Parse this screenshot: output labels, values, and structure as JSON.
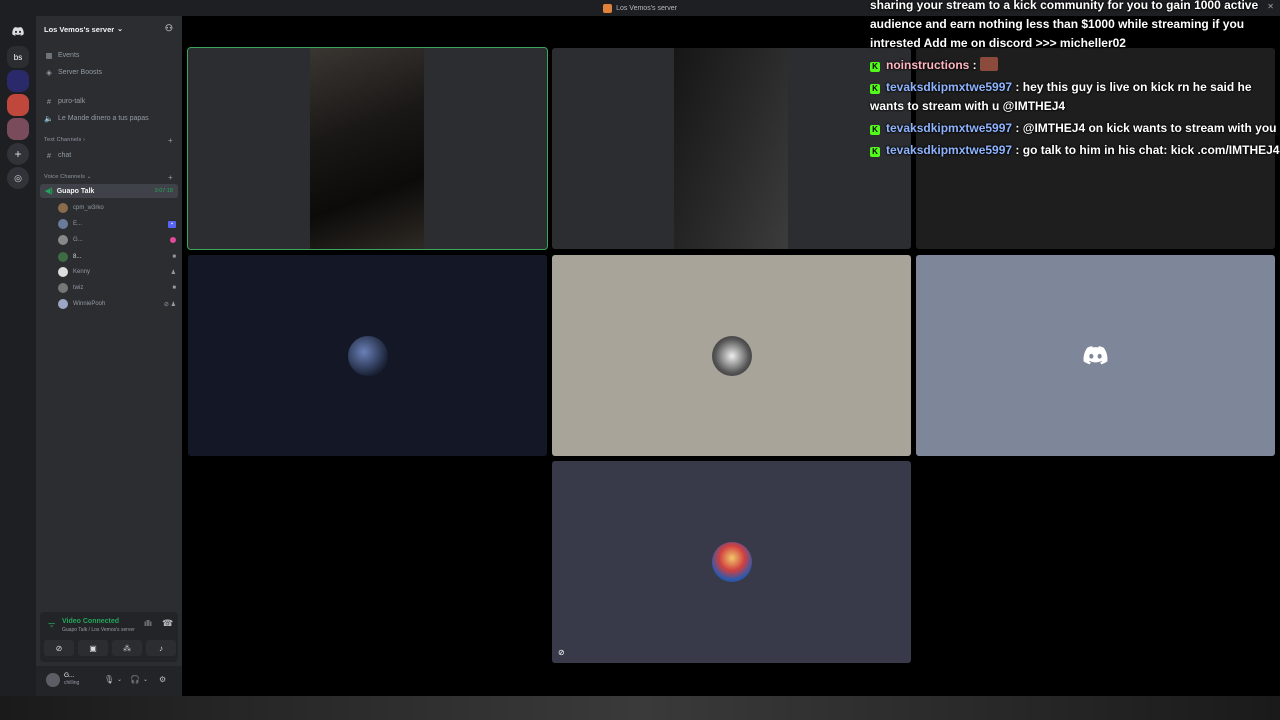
{
  "window": {
    "title": "Los Vemos's server"
  },
  "rail": {
    "home_icon": "discord-logo",
    "server_bs": "bs"
  },
  "server": {
    "name": "Los Vemos's server",
    "chevron": "⌄"
  },
  "sidebar": {
    "events": "Events",
    "boosts": "Server Boosts",
    "channels_top": [
      {
        "icon": "#",
        "label": "puro-talk"
      },
      {
        "icon": "🔊",
        "label": "Le Mande dinero a tus papas"
      }
    ],
    "text_category": "Text Channels ›",
    "text_channels": [
      {
        "icon": "#",
        "label": "chat"
      }
    ],
    "voice_category": "Voice Channels ⌄",
    "voice_channel": {
      "label": "Guapo Talk",
      "timer": "3:07:18"
    },
    "members": [
      {
        "name": "cpm_w3rko",
        "color": "#8a6b4a"
      },
      {
        "name": "E...",
        "color": "#6b7a9a"
      },
      {
        "name": "G...",
        "color": "#888"
      },
      {
        "name": "8...",
        "color": "#3d6b44"
      },
      {
        "name": "Kenny",
        "color": "#ddd"
      },
      {
        "name": "twiz",
        "color": "#777"
      },
      {
        "name": "WinniePooh",
        "color": "#9aa6c4"
      }
    ]
  },
  "voice_panel": {
    "status": "Video Connected",
    "location": "Guapo Talk / Los Vemos's server"
  },
  "user_panel": {
    "name": "G...",
    "status": "chilling"
  },
  "tiles": {
    "colors": {
      "tile1": "#2c2d30",
      "tile2": "#2c2d30",
      "tile3": "#1e1e1e",
      "tile4": "#141826",
      "tile5": "#a8a49a",
      "tile6": "#7e869a",
      "tile7": "#383a4a"
    }
  },
  "chat": {
    "messages": [
      {
        "user": "",
        "text": "sharing your stream to a kick community for you to gain 1000 active audience and earn nothing less than $1000 while streaming if you intrested Add me on discord >>> micheller02"
      },
      {
        "user": "noinstructions",
        "text": "",
        "emote": true
      },
      {
        "user": "tevaksdkipmxtwe5997",
        "text": "hey this guy is live on kick rn he said he wants to stream with u @IMTHEJ4"
      },
      {
        "user": "tevaksdkipmxtwe5997",
        "text": "@IMTHEJ4 on kick wants to stream with you"
      },
      {
        "user": "tevaksdkipmxtwe5997",
        "text": "go talk to him in his chat: kick .com/IMTHEJ4"
      }
    ]
  }
}
